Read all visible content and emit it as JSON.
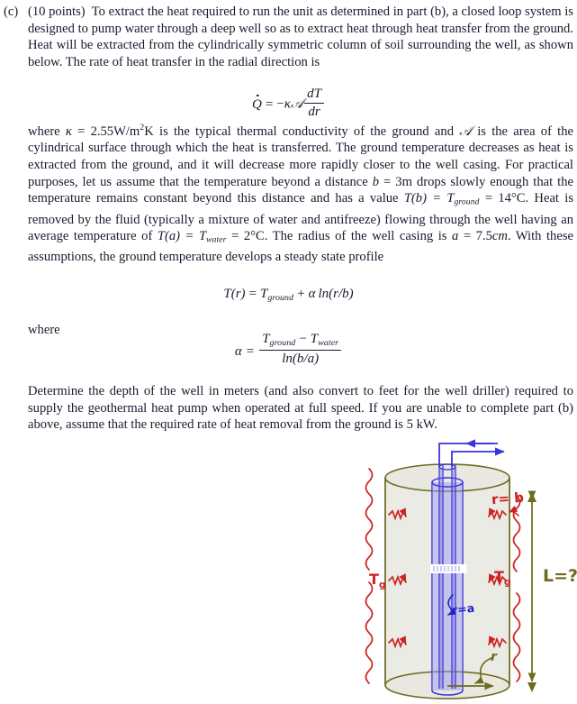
{
  "problem": {
    "label": "(c)",
    "points_prefix": "(10 points)",
    "paragraph_1": "To extract the heat required to run the unit as determined in part (b), a closed loop system is designed to pump water through a deep well so as to extract heat through heat transfer from the ground. Heat will be extracted from the cylindrically symmetric column of soil surrounding the well, as shown below. The rate of heat transfer in the radial direction is",
    "equation_1": {
      "lhs": "Q",
      "eq": "=",
      "sign": "−",
      "kappa": "κ",
      "area": "𝒜",
      "frac_num": "dT",
      "frac_den": "dr"
    },
    "paragraph_2_parts": {
      "a": "where ",
      "kappa": "κ",
      "b": " = 2.55W/m",
      "sup": "2",
      "c": "K is the typical thermal conductivity of the ground and ",
      "script_a": "𝒜",
      "d": " is the area of the cylindrical surface through which the heat is transferred. The ground temperature decreases as heat is extracted from the ground, and it will decrease more rapidly closer to the well casing. For practical purposes, let us assume that the temperature beyond a distance ",
      "b_sym": "b",
      "e": " = 3m drops slowly enough that the temperature remains constant beyond this distance and has a value ",
      "Tb": "T(b) = T",
      "Tb_sub": "ground",
      "f": " = 14°C. Heat is removed by the fluid (typically a mixture of water and antifreeze) flowing through the well having an average temperature of ",
      "Ta": "T(a) = T",
      "Ta_sub": "water",
      "g": " = 2°C. The radius of the well casing is ",
      "a_sym": "a",
      "h": " = 7.5",
      "cm": "cm",
      "i": ". With these assumptions, the ground temperature develops a steady state profile"
    },
    "equation_2": {
      "lhs": "T(r)",
      "eq": "=",
      "T": "T",
      "T_sub": "ground",
      "plus": "+",
      "alpha": "α",
      "ln": "ln(r/b)"
    },
    "where_label": "where",
    "equation_3": {
      "alpha": "α",
      "eq": "=",
      "num_T1": "T",
      "num_T1_sub": "ground",
      "num_minus": "−",
      "num_T2": "T",
      "num_T2_sub": "water",
      "den": "ln(b/a)"
    },
    "paragraph_3": "Determine the depth of the well in meters (and also convert to feet for the well driller) required to supply the geothermal heat pump when operated at full speed. If you are unable to complete part (b) above, assume that the required rate of heat removal from the ground is 5 kW."
  },
  "diagram": {
    "labels": {
      "r_equals_b": "r= b",
      "r_equals_a": "r=a",
      "T_g_left": "T",
      "T_g_left_sub": "g",
      "T_g_right": "T",
      "T_g_right_sub": "g",
      "L_question": "L=?",
      "r_bottom": "r"
    },
    "colors": {
      "cylinder_stroke": "#6e6b1e",
      "cylinder_fill": "#e8e8e0",
      "heat_red": "#cc2222",
      "pipe_blue": "#3b33dd",
      "pipe_fill": "#9a96ee",
      "dimension_olive": "#6e6b1e",
      "label_blue": "#2222cc"
    }
  }
}
